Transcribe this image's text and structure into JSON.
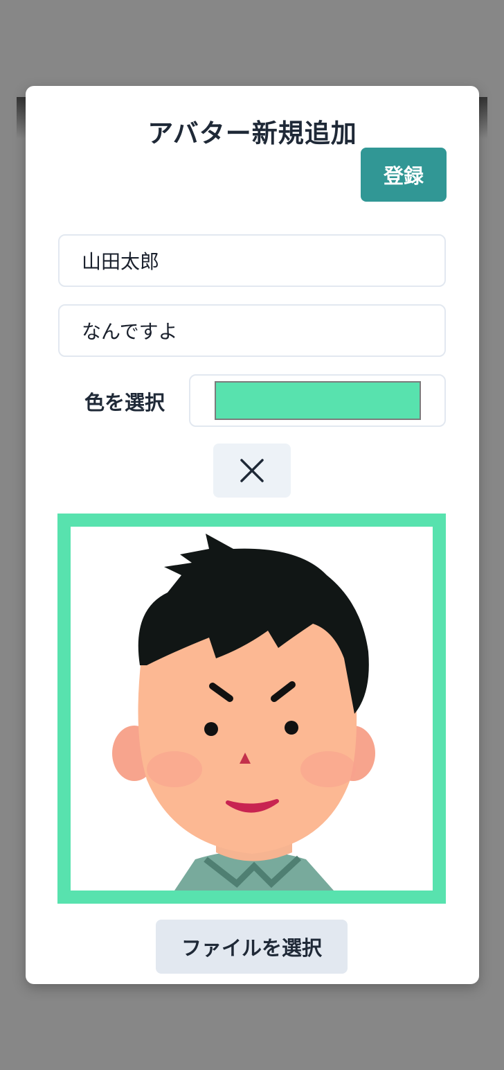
{
  "modal": {
    "title": "アバター新規追加",
    "register_label": "登録",
    "name_value": "山田太郎",
    "message_value": "なんですよ",
    "color_label": "色を選択",
    "selected_color": "#58e2ae",
    "close_icon": "close-icon",
    "file_button_label": "ファイルを選択"
  },
  "colors": {
    "accent": "#319795",
    "overlay": "#878787"
  }
}
